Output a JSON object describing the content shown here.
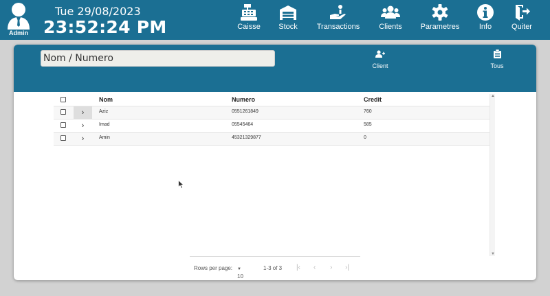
{
  "header": {
    "user_label": "Admin",
    "date": "Tue 29/08/2023",
    "time": "23:52:24 PM",
    "nav": [
      {
        "label": "Caisse",
        "icon": "cash-register-icon"
      },
      {
        "label": "Stock",
        "icon": "warehouse-icon"
      },
      {
        "label": "Transactions",
        "icon": "hand-coins-icon"
      },
      {
        "label": "Clients",
        "icon": "users-icon"
      },
      {
        "label": "Parametres",
        "icon": "gear-icon"
      },
      {
        "label": "Info",
        "icon": "info-icon"
      },
      {
        "label": "Quiter",
        "icon": "exit-icon"
      }
    ]
  },
  "toolbar": {
    "search_placeholder": "Nom / Numero",
    "add_client_label": "Client",
    "all_label": "Tous"
  },
  "table": {
    "columns": [
      "Nom",
      "Numero",
      "Credit"
    ],
    "rows": [
      {
        "nom": "Aziz",
        "numero": "0551261849",
        "credit": "760"
      },
      {
        "nom": "Imad",
        "numero": "05545464",
        "credit": "585"
      },
      {
        "nom": "Amin",
        "numero": "45321329877",
        "credit": "0"
      }
    ]
  },
  "pagination": {
    "rows_per_page_label": "Rows per page:",
    "rows_per_page_value": "10",
    "range_label": "1-3 of 3"
  }
}
